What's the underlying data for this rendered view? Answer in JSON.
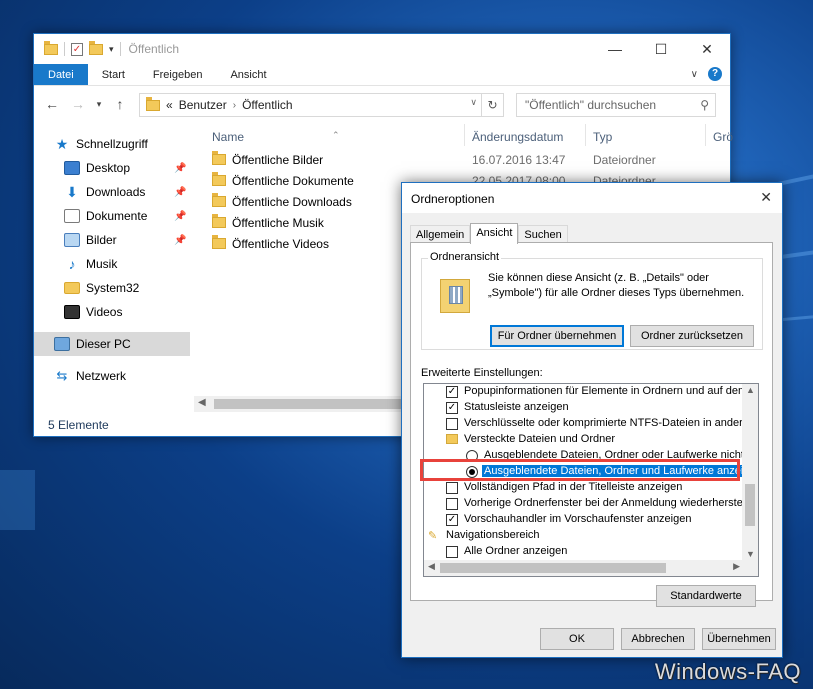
{
  "explorer": {
    "title": "Öffentlich",
    "ribbon_tabs": [
      "Datei",
      "Start",
      "Freigeben",
      "Ansicht"
    ],
    "address": {
      "prefix": "«",
      "crumbs": [
        "Benutzer",
        "Öffentlich"
      ]
    },
    "search_placeholder": "\"Öffentlich\" durchsuchen",
    "nav": {
      "quick_access": "Schnellzugriff",
      "items": [
        {
          "label": "Desktop",
          "icon": "desktop-icon",
          "pinned": true
        },
        {
          "label": "Downloads",
          "icon": "download-icon",
          "pinned": true
        },
        {
          "label": "Dokumente",
          "icon": "documents-icon",
          "pinned": true
        },
        {
          "label": "Bilder",
          "icon": "pictures-icon",
          "pinned": true
        },
        {
          "label": "Musik",
          "icon": "music-icon",
          "pinned": false
        },
        {
          "label": "System32",
          "icon": "folder-icon",
          "pinned": false
        },
        {
          "label": "Videos",
          "icon": "video-icon",
          "pinned": false
        }
      ],
      "this_pc": "Dieser PC",
      "network": "Netzwerk"
    },
    "columns": {
      "name": "Name",
      "date": "Änderungsdatum",
      "type": "Typ",
      "size": "Grö"
    },
    "files": [
      {
        "name": "Öffentliche Bilder",
        "date": "16.07.2016 13:47",
        "type": "Dateiordner"
      },
      {
        "name": "Öffentliche Dokumente",
        "date": "22.05.2017 08:00",
        "type": "Dateiordner"
      },
      {
        "name": "Öffentliche Downloads",
        "date": "",
        "type": ""
      },
      {
        "name": "Öffentliche Musik",
        "date": "",
        "type": ""
      },
      {
        "name": "Öffentliche Videos",
        "date": "",
        "type": ""
      }
    ],
    "status": "5 Elemente"
  },
  "dialog": {
    "title": "Ordneroptionen",
    "tabs": [
      "Allgemein",
      "Ansicht",
      "Suchen"
    ],
    "group_title": "Ordneransicht",
    "group_desc": "Sie können diese Ansicht (z. B. „Details\" oder „Symbole\") für alle Ordner dieses Typs übernehmen.",
    "apply_btn": "Für Ordner übernehmen",
    "reset_btn": "Ordner zurücksetzen",
    "advanced_label": "Erweiterte Einstellungen:",
    "settings": [
      {
        "kind": "check",
        "checked": true,
        "indent": 1,
        "label": "Popupinformationen für Elemente in Ordnern und auf dem D"
      },
      {
        "kind": "check",
        "checked": true,
        "indent": 1,
        "label": "Statusleiste anzeigen"
      },
      {
        "kind": "check",
        "checked": false,
        "indent": 1,
        "label": "Verschlüsselte oder komprimierte NTFS-Dateien in anderer"
      },
      {
        "kind": "folder",
        "indent": 1,
        "label": "Versteckte Dateien und Ordner"
      },
      {
        "kind": "radio",
        "checked": false,
        "indent": 2,
        "label": "Ausgeblendete Dateien, Ordner oder Laufwerke nicht a"
      },
      {
        "kind": "radio",
        "checked": true,
        "indent": 2,
        "highlight": true,
        "label": "Ausgeblendete Dateien, Ordner und Laufwerke anzeig"
      },
      {
        "kind": "check",
        "checked": false,
        "indent": 1,
        "label": "Vollständigen Pfad in der Titelleiste anzeigen"
      },
      {
        "kind": "check",
        "checked": false,
        "indent": 1,
        "label": "Vorherige Ordnerfenster bei der Anmeldung wiederherstell"
      },
      {
        "kind": "check",
        "checked": true,
        "indent": 1,
        "label": "Vorschauhandler im Vorschaufenster anzeigen"
      },
      {
        "kind": "nav",
        "indent": 0,
        "label": "Navigationsbereich"
      },
      {
        "kind": "check",
        "checked": false,
        "indent": 1,
        "label": "Alle Ordner anzeigen"
      }
    ],
    "defaults_btn": "Standardwerte",
    "ok_btn": "OK",
    "cancel_btn": "Abbrechen",
    "apply_dlg_btn": "Übernehmen"
  },
  "watermark": "Windows-FAQ",
  "colors": {
    "accent": "#0078d7",
    "highlight_box": "#e8423b"
  }
}
